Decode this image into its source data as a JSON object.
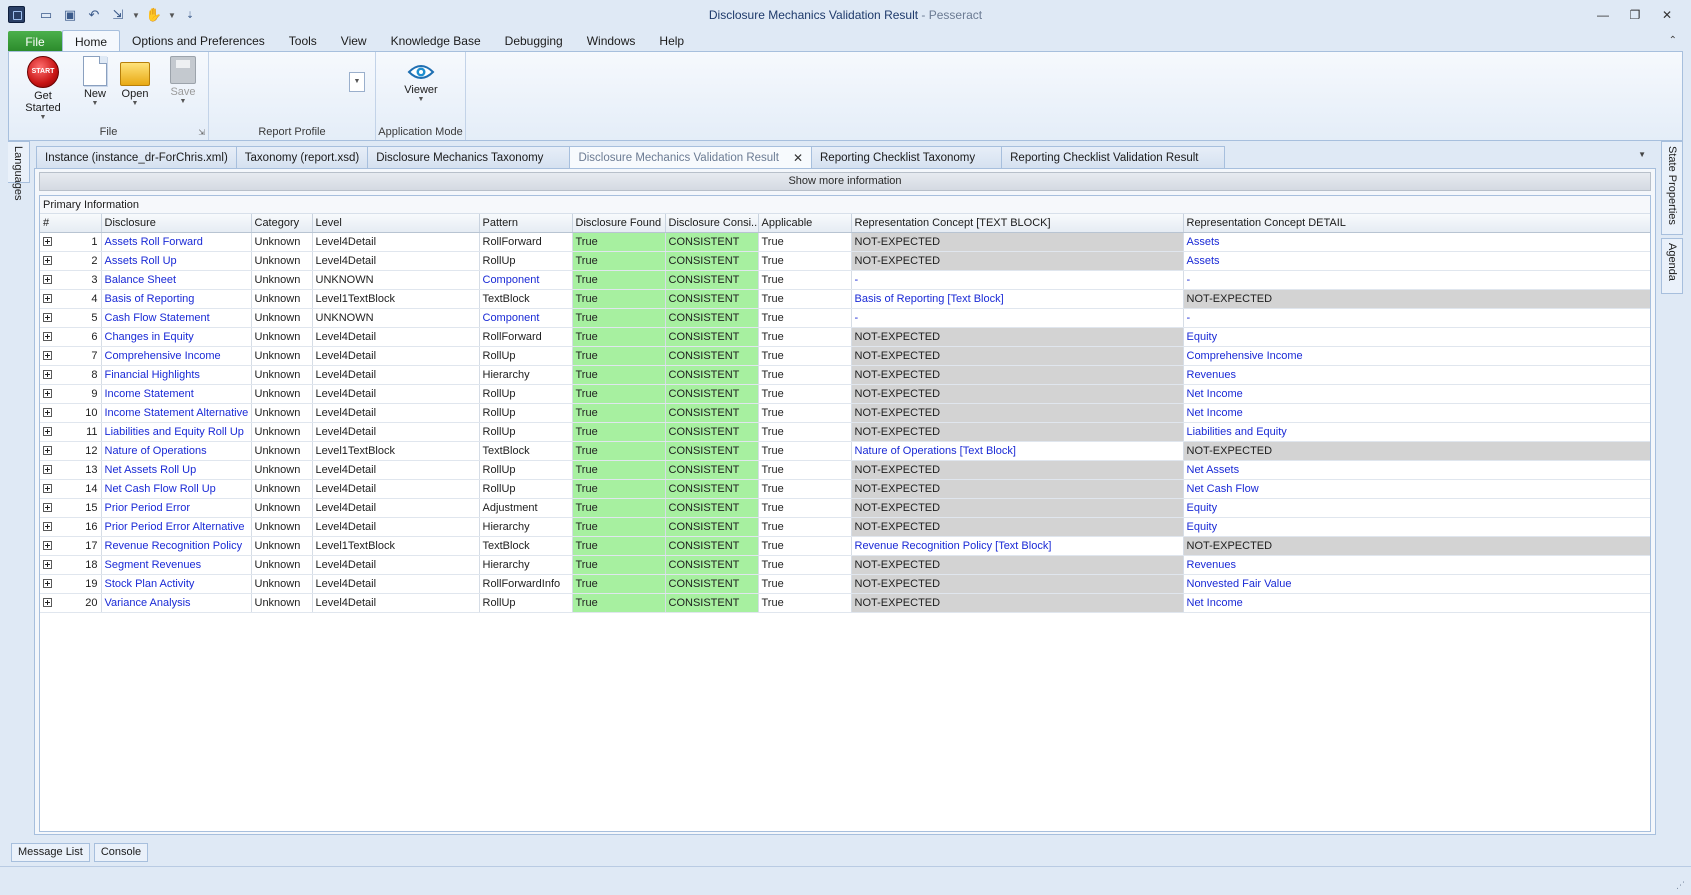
{
  "window": {
    "title": "Disclosure Mechanics Validation Result",
    "separator": " - ",
    "app_name": "Pesseract"
  },
  "ribbon": {
    "file_tab": "File",
    "tabs": [
      "Home",
      "Options and Preferences",
      "Tools",
      "View",
      "Knowledge Base",
      "Debugging",
      "Windows",
      "Help"
    ],
    "active_tab": "Home",
    "groups": {
      "file": {
        "label": "File",
        "get_started": "Get Started",
        "start_badge": "START",
        "new": "New",
        "open": "Open",
        "save": "Save"
      },
      "report_profile": {
        "label": "Report Profile"
      },
      "application_mode": {
        "label": "Application Mode",
        "viewer": "Viewer"
      }
    }
  },
  "side_panels": {
    "left": "Languages",
    "right": [
      "State Properties",
      "Agenda"
    ]
  },
  "doc_tabs": [
    {
      "label": "Instance (instance_dr-ForChris.xml)"
    },
    {
      "label": "Taxonomy (report.xsd)"
    },
    {
      "label": "Disclosure Mechanics Taxonomy"
    },
    {
      "label": "Disclosure Mechanics Validation Result"
    },
    {
      "label": "Reporting Checklist Taxonomy"
    },
    {
      "label": "Reporting Checklist Validation Result"
    }
  ],
  "active_doc_tab": "Disclosure Mechanics Validation Result",
  "show_more": "Show more information",
  "grid": {
    "group_title": "Primary Information",
    "columns": [
      "#",
      "Disclosure",
      "Category",
      "Level",
      "Pattern",
      "Disclosure Found",
      "Disclosure Consi...",
      "Applicable",
      "Representation Concept [TEXT BLOCK]",
      "Representation Concept DETAIL"
    ],
    "rows": [
      {
        "n": "1",
        "disclosure": "Assets Roll Forward",
        "category": "Unknown",
        "level": "Level4Detail",
        "pattern": "RollForward",
        "found": "True",
        "consistent": "CONSISTENT",
        "applicable": "True",
        "textblock": "NOT-EXPECTED",
        "detail": "Assets"
      },
      {
        "n": "2",
        "disclosure": "Assets Roll Up",
        "category": "Unknown",
        "level": "Level4Detail",
        "pattern": "RollUp",
        "found": "True",
        "consistent": "CONSISTENT",
        "applicable": "True",
        "textblock": "NOT-EXPECTED",
        "detail": "Assets"
      },
      {
        "n": "3",
        "disclosure": "Balance Sheet",
        "category": "Unknown",
        "level": "UNKNOWN",
        "pattern": "Component",
        "found": "True",
        "consistent": "CONSISTENT",
        "applicable": "True",
        "textblock": "-",
        "detail": "-"
      },
      {
        "n": "4",
        "disclosure": "Basis of Reporting",
        "category": "Unknown",
        "level": "Level1TextBlock",
        "pattern": "TextBlock",
        "found": "True",
        "consistent": "CONSISTENT",
        "applicable": "True",
        "textblock": "Basis of Reporting [Text Block]",
        "detail": "NOT-EXPECTED"
      },
      {
        "n": "5",
        "disclosure": "Cash Flow Statement",
        "category": "Unknown",
        "level": "UNKNOWN",
        "pattern": "Component",
        "found": "True",
        "consistent": "CONSISTENT",
        "applicable": "True",
        "textblock": "-",
        "detail": "-"
      },
      {
        "n": "6",
        "disclosure": "Changes in Equity",
        "category": "Unknown",
        "level": "Level4Detail",
        "pattern": "RollForward",
        "found": "True",
        "consistent": "CONSISTENT",
        "applicable": "True",
        "textblock": "NOT-EXPECTED",
        "detail": "Equity"
      },
      {
        "n": "7",
        "disclosure": "Comprehensive Income",
        "category": "Unknown",
        "level": "Level4Detail",
        "pattern": "RollUp",
        "found": "True",
        "consistent": "CONSISTENT",
        "applicable": "True",
        "textblock": "NOT-EXPECTED",
        "detail": "Comprehensive Income"
      },
      {
        "n": "8",
        "disclosure": "Financial Highlights",
        "category": "Unknown",
        "level": "Level4Detail",
        "pattern": "Hierarchy",
        "found": "True",
        "consistent": "CONSISTENT",
        "applicable": "True",
        "textblock": "NOT-EXPECTED",
        "detail": "Revenues"
      },
      {
        "n": "9",
        "disclosure": "Income Statement",
        "category": "Unknown",
        "level": "Level4Detail",
        "pattern": "RollUp",
        "found": "True",
        "consistent": "CONSISTENT",
        "applicable": "True",
        "textblock": "NOT-EXPECTED",
        "detail": "Net Income"
      },
      {
        "n": "10",
        "disclosure": "Income Statement Alternative",
        "category": "Unknown",
        "level": "Level4Detail",
        "pattern": "RollUp",
        "found": "True",
        "consistent": "CONSISTENT",
        "applicable": "True",
        "textblock": "NOT-EXPECTED",
        "detail": "Net Income"
      },
      {
        "n": "11",
        "disclosure": "Liabilities and Equity Roll Up",
        "category": "Unknown",
        "level": "Level4Detail",
        "pattern": "RollUp",
        "found": "True",
        "consistent": "CONSISTENT",
        "applicable": "True",
        "textblock": "NOT-EXPECTED",
        "detail": "Liabilities and Equity"
      },
      {
        "n": "12",
        "disclosure": "Nature of Operations",
        "category": "Unknown",
        "level": "Level1TextBlock",
        "pattern": "TextBlock",
        "found": "True",
        "consistent": "CONSISTENT",
        "applicable": "True",
        "textblock": "Nature of Operations [Text Block]",
        "detail": "NOT-EXPECTED"
      },
      {
        "n": "13",
        "disclosure": "Net Assets Roll Up",
        "category": "Unknown",
        "level": "Level4Detail",
        "pattern": "RollUp",
        "found": "True",
        "consistent": "CONSISTENT",
        "applicable": "True",
        "textblock": "NOT-EXPECTED",
        "detail": "Net Assets"
      },
      {
        "n": "14",
        "disclosure": "Net Cash Flow Roll Up",
        "category": "Unknown",
        "level": "Level4Detail",
        "pattern": "RollUp",
        "found": "True",
        "consistent": "CONSISTENT",
        "applicable": "True",
        "textblock": "NOT-EXPECTED",
        "detail": "Net Cash Flow"
      },
      {
        "n": "15",
        "disclosure": "Prior Period Error",
        "category": "Unknown",
        "level": "Level4Detail",
        "pattern": "Adjustment",
        "found": "True",
        "consistent": "CONSISTENT",
        "applicable": "True",
        "textblock": "NOT-EXPECTED",
        "detail": "Equity"
      },
      {
        "n": "16",
        "disclosure": "Prior Period Error Alternative",
        "category": "Unknown",
        "level": "Level4Detail",
        "pattern": "Hierarchy",
        "found": "True",
        "consistent": "CONSISTENT",
        "applicable": "True",
        "textblock": "NOT-EXPECTED",
        "detail": "Equity"
      },
      {
        "n": "17",
        "disclosure": "Revenue Recognition Policy",
        "category": "Unknown",
        "level": "Level1TextBlock",
        "pattern": "TextBlock",
        "found": "True",
        "consistent": "CONSISTENT",
        "applicable": "True",
        "textblock": "Revenue Recognition Policy [Text Block]",
        "detail": "NOT-EXPECTED"
      },
      {
        "n": "18",
        "disclosure": "Segment Revenues",
        "category": "Unknown",
        "level": "Level4Detail",
        "pattern": "Hierarchy",
        "found": "True",
        "consistent": "CONSISTENT",
        "applicable": "True",
        "textblock": "NOT-EXPECTED",
        "detail": "Revenues"
      },
      {
        "n": "19",
        "disclosure": "Stock Plan Activity",
        "category": "Unknown",
        "level": "Level4Detail",
        "pattern": "RollForwardInfo",
        "found": "True",
        "consistent": "CONSISTENT",
        "applicable": "True",
        "textblock": "NOT-EXPECTED",
        "detail": "Nonvested Fair Value"
      },
      {
        "n": "20",
        "disclosure": "Variance Analysis",
        "category": "Unknown",
        "level": "Level4Detail",
        "pattern": "RollUp",
        "found": "True",
        "consistent": "CONSISTENT",
        "applicable": "True",
        "textblock": "NOT-EXPECTED",
        "detail": "Net Income"
      }
    ]
  },
  "bottom_tabs": [
    "Message List",
    "Console"
  ],
  "colors": {
    "link": "#1a2ad6",
    "found_bg": "#a7f0a0",
    "not_expected_bg": "#d3d3d3",
    "file_tab": "#2a8a2a"
  },
  "icons": {
    "qat": [
      "app-icon",
      "blank-doc-icon",
      "save-icon",
      "undo-icon",
      "open-icon",
      "hand-icon",
      "customize-icon"
    ]
  }
}
